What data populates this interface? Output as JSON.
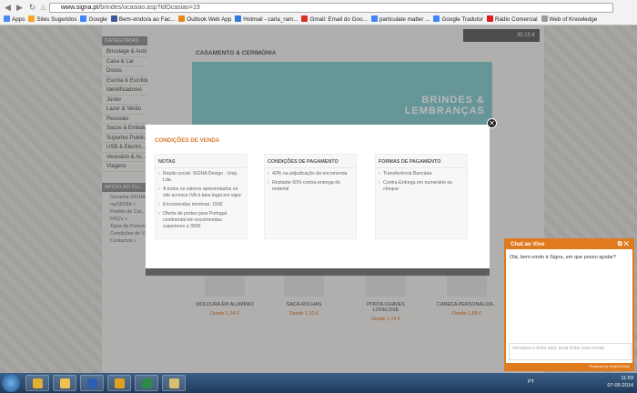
{
  "browser": {
    "url_host": "www.signa.pt",
    "url_path": "/brindes/ocasiao.asp?IdOcasiao=19",
    "bookmarks": [
      {
        "label": "Apps",
        "color": "#4c8bf5"
      },
      {
        "label": "Sites Sugeridos",
        "color": "#f5a623"
      },
      {
        "label": "Google",
        "color": "#4285f4"
      },
      {
        "label": "Bem-vindo/a ao Fac...",
        "color": "#3b5998"
      },
      {
        "label": "Outlook Web App",
        "color": "#e38b1a"
      },
      {
        "label": "Hotmail - carla_ram...",
        "color": "#2d7dd2"
      },
      {
        "label": "Gmail: Email do Goo...",
        "color": "#d93025"
      },
      {
        "label": "particulate matter ...",
        "color": "#4285f4"
      },
      {
        "label": "Google Tradutor",
        "color": "#4285f4"
      },
      {
        "label": "Rádio Comercial",
        "color": "#e11b22"
      },
      {
        "label": "Web of Knowledge",
        "color": "#9a9a9a"
      }
    ]
  },
  "site": {
    "cart_text": "35,15 €",
    "section_title": "CASAMENTO & CERIMÓNIA",
    "banner_text_1": "BRINDES &",
    "banner_text_2": "LEMBRANÇAS",
    "sidebar": {
      "header": "CATEGORIAS",
      "items": [
        "Bricolage & Auto",
        "Casa & Lar",
        "Doces",
        "Escrita & Escritório",
        "Identificadores",
        "Júnior",
        "Lazer & Verão",
        "Pessoais",
        "Sacos & Embala...",
        "Suportes Public...",
        "USB & Electró...",
        "Vestuário & Ac...",
        "Viagens"
      ],
      "support_header": "APOIO AO CLI...",
      "support_items": [
        "Garantia SIGNA",
        "mySIGNA »",
        "Pedido de Cat...",
        "FAQ's »",
        "Tipos de Person...",
        "Condições de V...",
        "Contactos »"
      ]
    },
    "products": [
      {
        "name": "MOLDURA EM ALUMÍNIO",
        "price": "Desde 1,34 €"
      },
      {
        "name": "SACA-ROLHAS",
        "price": "Desde 1,10 €"
      },
      {
        "name": "PORTA-CHAVES LOVELOVE",
        "price": "Desde 1,14 €"
      },
      {
        "name": "CANECA PERSONALIZA...",
        "price": "Desde 1,89 €"
      }
    ]
  },
  "modal": {
    "title": "CONDIÇÕES DE VENDA",
    "close_symbol": "✕",
    "columns": [
      {
        "header": "NOTAS",
        "items": [
          "Razão social: SIGNA Design - Unip. Lda.",
          "A todos os valores apresentados no site acresce IVA à taxa legal em vigor",
          "Encomendas mínimas: 150€",
          "Oferta de portes para Portugal continental em encomendas superiores a 300€"
        ]
      },
      {
        "header": "CONDIÇÕES DE PAGAMENTO",
        "items": [
          "40% na adjudicação da encomenda",
          "Restante 60% contra-entrega do material"
        ]
      },
      {
        "header": "FORMAS DE PAGAMENTO",
        "items": [
          "Transferência Bancária",
          "Contra-Entrega em numerário ou cheque"
        ]
      }
    ]
  },
  "chat": {
    "title": "Chat ao Vivo",
    "message": "Olá, bem-vindo à Signa, em que posso ajudar?",
    "input_placeholder": "Introduza o texto aqui, tecla Enter para enviar.",
    "footer": "Powered by HelpOnClick"
  },
  "taskbar": {
    "lang": "PT",
    "time": "11:03",
    "date": "07-05-2014",
    "apps": [
      {
        "name": "chrome",
        "color": "#e0b030"
      },
      {
        "name": "explorer",
        "color": "#f0c050"
      },
      {
        "name": "word",
        "color": "#2b5fb4"
      },
      {
        "name": "outlook",
        "color": "#e0a020"
      },
      {
        "name": "excel",
        "color": "#2e8b47"
      },
      {
        "name": "paint",
        "color": "#d8c070"
      }
    ]
  }
}
